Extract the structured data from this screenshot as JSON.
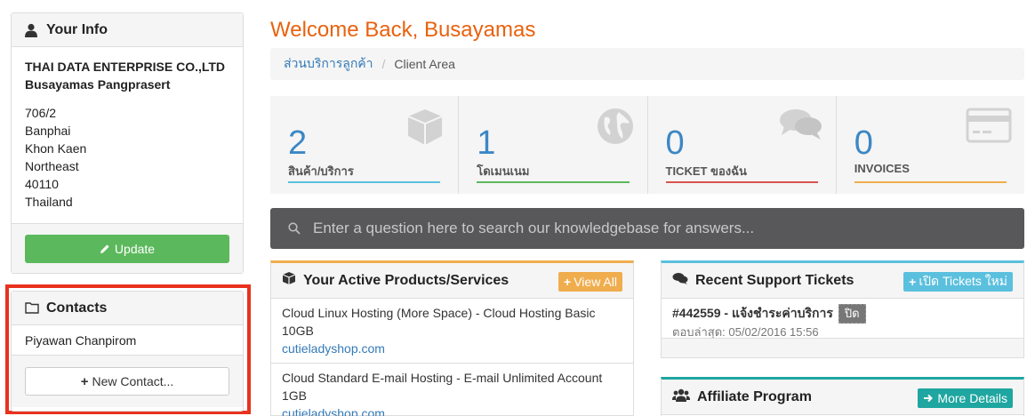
{
  "your_info": {
    "title": "Your Info",
    "company": "THAI DATA ENTERPRISE CO.,LTD",
    "name": "Busayamas Pangprasert",
    "address_lines": [
      "706/2",
      "Banphai",
      "Khon Kaen",
      "Northeast",
      "40110",
      "Thailand"
    ],
    "update_label": "Update"
  },
  "contacts": {
    "title": "Contacts",
    "items": [
      "Piyawan Chanpirom"
    ],
    "new_contact_label": "New Contact..."
  },
  "welcome": "Welcome Back, Busayamas",
  "breadcrumb": {
    "home": "ส่วนบริการลูกค้า",
    "current": "Client Area"
  },
  "tiles": [
    {
      "value": "2",
      "label": "สินค้า/บริการ",
      "color": "#5bc0de",
      "icon": "cube-icon"
    },
    {
      "value": "1",
      "label": "โดเมนเนม",
      "color": "#5cb85c",
      "icon": "globe-icon"
    },
    {
      "value": "0",
      "label": "TICKET ของฉัน",
      "color": "#d9534f",
      "icon": "comments-icon"
    },
    {
      "value": "0",
      "label": "INVOICES",
      "color": "#f0ad4e",
      "icon": "credit-card-icon"
    }
  ],
  "kb_search": {
    "placeholder": "Enter a question here to search our knowledgebase for answers..."
  },
  "products": {
    "title": "Your Active Products/Services",
    "view_all_label": "View All",
    "items": [
      {
        "name": "Cloud Linux Hosting (More Space) - Cloud Hosting Basic 10GB",
        "domain": "cutieladyshop.com"
      },
      {
        "name": "Cloud Standard E-mail Hosting - E-mail Unlimited Account 1GB",
        "domain": "cutieladyshop.com"
      }
    ]
  },
  "tickets": {
    "title": "Recent Support Tickets",
    "open_ticket_label": "เปิด Tickets ใหม่",
    "items": [
      {
        "title": "#442559 - แจ้งชำระค่าบริการ",
        "status": "ปิด",
        "last_reply": "ตอบล่าสุด: 05/02/2016 15:56"
      }
    ]
  },
  "affiliate": {
    "title": "Affiliate Program",
    "more_label": "More Details"
  },
  "colors": {
    "accent": "#e8620f",
    "success": "#5cb85c",
    "info": "#5bc0de",
    "warning": "#f0ad4e",
    "teal": "#1fa6a0",
    "highlight": "#e8321e"
  }
}
